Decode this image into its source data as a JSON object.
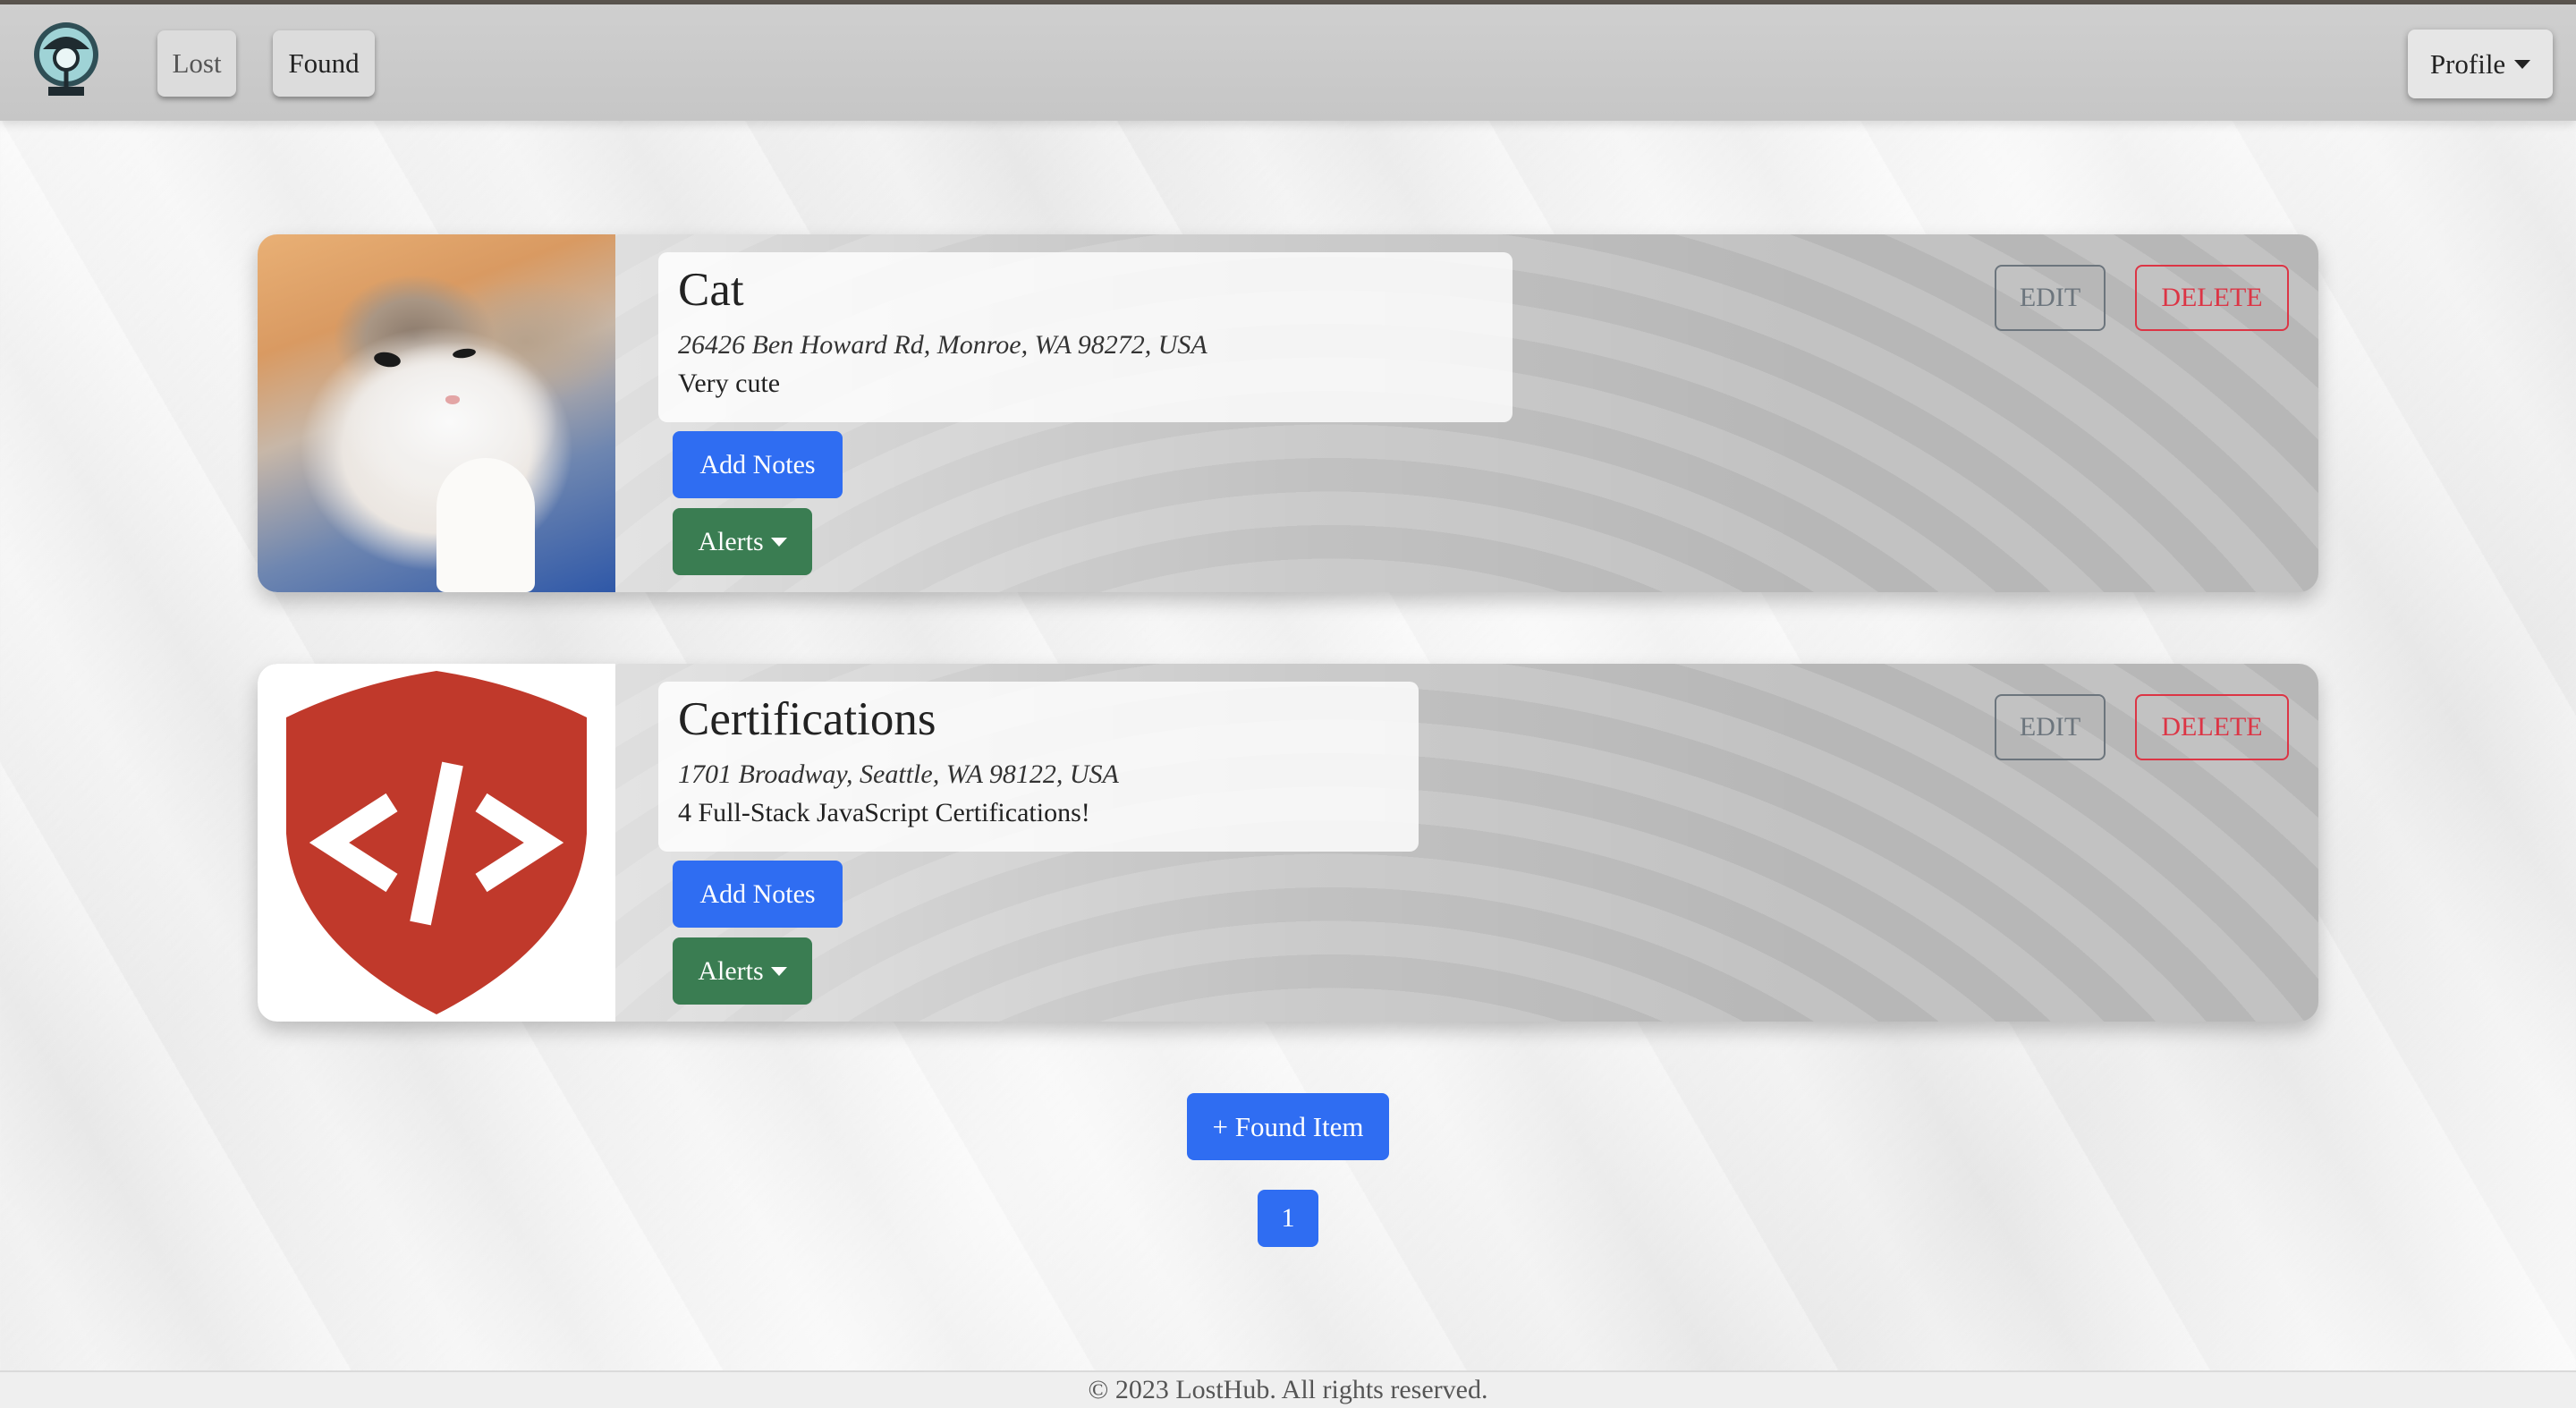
{
  "navbar": {
    "lost_label": "Lost",
    "found_label": "Found",
    "profile_label": "Profile"
  },
  "items": [
    {
      "title": "Cat",
      "address": "26426 Ben Howard Rd, Monroe, WA 98272, USA",
      "description": "Very cute",
      "image": "cat-photo",
      "add_notes_label": "Add Notes",
      "alerts_label": "Alerts",
      "edit_label": "EDIT",
      "delete_label": "DELETE"
    },
    {
      "title": "Certifications",
      "address": "1701 Broadway, Seattle, WA 98122, USA",
      "description": "4 Full-Stack JavaScript Certifications!",
      "image": "code-shield-icon",
      "add_notes_label": "Add Notes",
      "alerts_label": "Alerts",
      "edit_label": "EDIT",
      "delete_label": "DELETE"
    }
  ],
  "actions": {
    "found_item_label": "+ Found Item"
  },
  "pagination": {
    "current_page": "1"
  },
  "footer": {
    "text": "© 2023 LostHub. All rights reserved."
  },
  "colors": {
    "primary": "#2f6df2",
    "success": "#3a7d52",
    "danger": "#dc3545",
    "secondary": "#6c757d",
    "shield": "#c0392b"
  }
}
